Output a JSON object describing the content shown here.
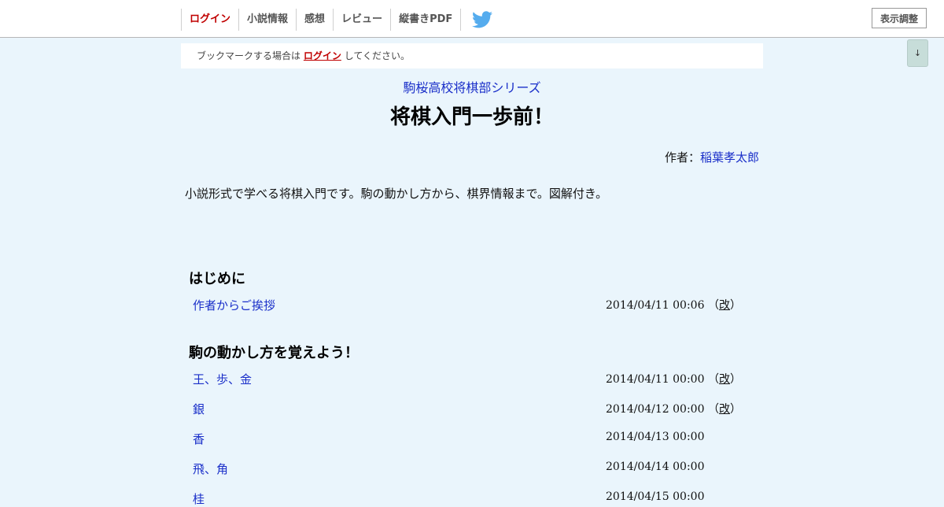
{
  "nav": {
    "login": "ログイン",
    "novel_info": "小説情報",
    "impressions": "感想",
    "review": "レビュー",
    "vertical_pdf": "縦書きPDF",
    "display_settings": "表示調整",
    "scroll_down": "↓"
  },
  "notice": {
    "before": "ブックマークする場合は",
    "link": "ログイン",
    "after": "してください。"
  },
  "novel": {
    "series": "駒桜高校将棋部シリーズ",
    "title": "将棋入門一歩前！",
    "author_label": "作者：",
    "author_name": "稲葉孝太郎",
    "synopsis": "小説形式で学べる将棋入門です。駒の動かし方から、棋界情報まで。図解付き。"
  },
  "chapters": [
    {
      "title": "はじめに",
      "episodes": [
        {
          "title": "作者からご挨拶",
          "date": "2014/04/11 00:06",
          "revised": "改"
        }
      ]
    },
    {
      "title": "駒の動かし方を覚えよう！",
      "episodes": [
        {
          "title": "王、歩、金",
          "date": "2014/04/11 00:00",
          "revised": "改"
        },
        {
          "title": "銀",
          "date": "2014/04/12 00:00",
          "revised": "改"
        },
        {
          "title": "香",
          "date": "2014/04/13 00:00",
          "revised": ""
        },
        {
          "title": "飛、角",
          "date": "2014/04/14 00:00",
          "revised": ""
        },
        {
          "title": "桂",
          "date": "2014/04/15 00:00",
          "revised": ""
        }
      ]
    }
  ],
  "colors": {
    "link": "#1a2fc9",
    "login": "#c00000",
    "background": "#eaf5fc",
    "twitter": "#55acee"
  },
  "icons": {
    "twitter": "twitter-bird-icon"
  }
}
